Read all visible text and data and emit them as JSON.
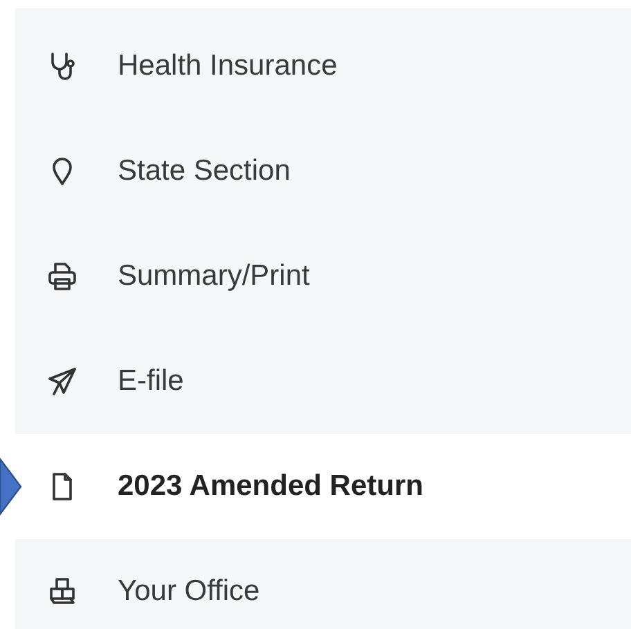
{
  "menu": [
    {
      "label": "Health Insurance",
      "selected": false
    },
    {
      "label": "State Section",
      "selected": false
    },
    {
      "label": "Summary/Print",
      "selected": false
    },
    {
      "label": "E-file",
      "selected": false
    },
    {
      "label": "2023 Amended Return",
      "selected": true
    },
    {
      "label": "Your Office",
      "selected": false
    }
  ]
}
